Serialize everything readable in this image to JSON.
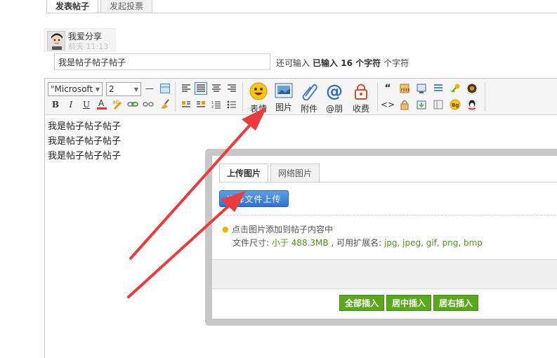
{
  "tabs": [
    "发表帖子",
    "发起投票"
  ],
  "user": {
    "name": "我爱分享",
    "time": "前天 11:13"
  },
  "title_input": {
    "value": "我是帖子帖子帖子"
  },
  "char_count": {
    "prefix": "还可输入",
    "entered_label": "已输入",
    "count": "16",
    "unit_label": "个字符",
    "suffix": "个字符"
  },
  "toolbar": {
    "font": "\"Microsoft",
    "size": "2",
    "big_buttons": {
      "emoji": "表情",
      "image": "图片",
      "attach": "附件",
      "at": "@朋",
      "pay": "收费"
    },
    "icons": [
      "bold-icon",
      "italic-icon",
      "underline-icon",
      "font-color-icon",
      "bg-color-icon",
      "link-icon",
      "unlink-icon",
      "clear-format-icon"
    ]
  },
  "editor_content": [
    "我是帖子帖子帖子",
    "我是帖子帖子帖子",
    "我是帖子帖子帖子"
  ],
  "upload_dialog": {
    "tabs": [
      "上传图片",
      "网络图片"
    ],
    "upload_button": "选择文件上传",
    "hint": "点击图片添加到帖子内容中",
    "size_label": "文件尺寸: ",
    "size_value": "小于 488.3MB",
    "ext_label": " , 可用扩展名: ",
    "ext_value": "jpg, jpeg, gif, png, bmp",
    "buttons": [
      "全部插入",
      "居中插入",
      "居右插入"
    ]
  },
  "colors": {
    "arrow": "#ec3b3b",
    "upload_button": "#3a7fda",
    "insert_button": "#5aa91c",
    "hint_green": "#4d9a17"
  }
}
